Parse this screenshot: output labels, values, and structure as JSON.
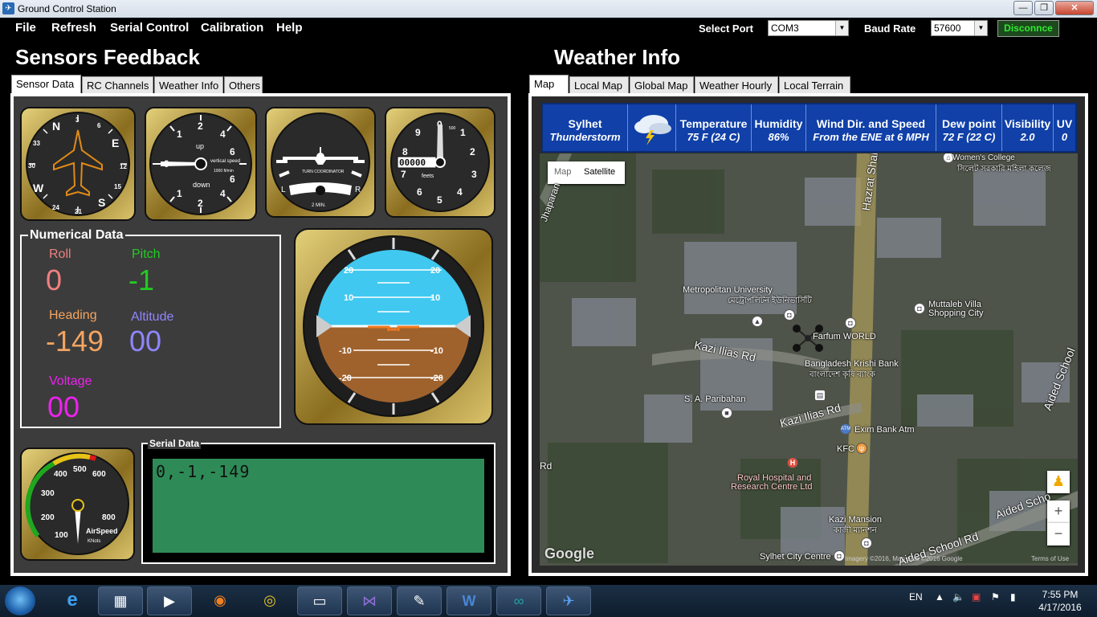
{
  "window": {
    "title": "Ground Control Station",
    "min": "—",
    "max": "❐",
    "close": "✕"
  },
  "menu": {
    "file": "File",
    "refresh": "Refresh",
    "serial_control": "Serial Control",
    "calibration": "Calibration",
    "help": "Help"
  },
  "port": {
    "label": "Select Port",
    "value": "COM3"
  },
  "baud": {
    "label": "Baud Rate",
    "value": "57600"
  },
  "disconnect_label": "Disconnce",
  "sensors": {
    "heading": "Sensors Feedback",
    "tabs": [
      "Sensor Data",
      "RC Channels",
      "Weather Info",
      "Others"
    ],
    "numerical": {
      "legend": "Numerical Data",
      "roll_label": "Roll",
      "roll_value": "0",
      "pitch_label": "Pitch",
      "pitch_value": "-1",
      "heading_label": "Heading",
      "heading_value": "-149",
      "altitude_label": "Altitude",
      "altitude_value": "00",
      "voltage_label": "Voltage",
      "voltage_value": "00"
    },
    "serial": {
      "legend": "Serial Data",
      "text": "0,-1,-149"
    },
    "gauges": {
      "compass": {
        "N": "N",
        "E": "E",
        "S": "S",
        "W": "W",
        "t3": "3",
        "t6": "6",
        "t12": "12",
        "t15": "15",
        "t21": "21",
        "t24": "24",
        "t30": "30",
        "t33": "33"
      },
      "vsi": {
        "up": "up",
        "down": "down",
        "title": "vertical speed",
        "unit": "1000 ft/min",
        "n0": "0",
        "n1": "1",
        "n2": "2",
        "n4": "4",
        "n6": "6"
      },
      "turn": {
        "title": "TURN COORDINATOR",
        "l": "L",
        "r": "R",
        "min": "2 MIN."
      },
      "alt": {
        "counter": "00000",
        "unit": "feets",
        "n0": "0",
        "n1": "1",
        "n2": "2",
        "n3": "3",
        "n4": "4",
        "n5": "5",
        "n6": "6",
        "n7": "7",
        "n8": "8",
        "n9": "9",
        "n500": "500"
      },
      "attitude": {
        "p20": "20",
        "p10": "10",
        "m10": "-10",
        "m20": "-20"
      },
      "airspeed": {
        "title": "AirSpeed",
        "unit": "KNots",
        "n100": "100",
        "n200": "200",
        "n300": "300",
        "n400": "400",
        "n500": "500",
        "n600": "600",
        "n800": "800"
      }
    }
  },
  "weather": {
    "heading": "Weather Info",
    "tabs": [
      "Map",
      "Local Map",
      "Global Map",
      "Weather Hourly",
      "Local Terrain"
    ],
    "location": "Sylhet",
    "condition": "Thunderstorm",
    "temperature_label": "Temperature",
    "temperature_value": "75 F (24 C)",
    "humidity_label": "Humidity",
    "humidity_value": "86%",
    "wind_label": "Wind Dir. and Speed",
    "wind_value": "From the ENE at 6 MPH",
    "dew_label": "Dew point",
    "dew_value": "72 F (22 C)",
    "visibility_label": "Visibility",
    "visibility_value": "2.0",
    "uv_label": "UV",
    "uv_value": "0"
  },
  "map": {
    "type_map": "Map",
    "type_satellite": "Satellite",
    "labels": {
      "metro": "Metropolitan University",
      "metro_bn": "মেট্রোপলিটন ইউনিভার্সিটি",
      "muttaleb": "Muttaleb Villa",
      "muttaleb2": "Shopping City",
      "farfum": "Farfum WORLD",
      "krishi": "Bangladesh Krishi Bank",
      "krishi_bn": "বাংলাদেশ কৃষি ব্যাংক",
      "paribahan": "S. A. Paribahan",
      "exim": "Exim Bank Atm",
      "kfc": "KFC",
      "royal": "Royal Hospital and",
      "royal2": "Research Centre Ltd",
      "kazi_mansion": "Kazi Mansion",
      "kazi_mansion_bn": "কাজী ম্যানশন",
      "city_centre": "Sylhet City Centre",
      "womens": "Women's College",
      "womens_bn": "সিলেট সরকারি মহিলা কলেজ",
      "road_kazi1": "Kazi Ilias Rd",
      "road_kazi2": "Kazi Ilias Rd",
      "road_hazrat": "Hazrat Shahjalal",
      "road_aided": "Aided School Rd",
      "road_aided2": "Aided Scho",
      "road_aided3": "Aided School",
      "road_jhaparan": "Jhaparan",
      "road_rd": "Rd",
      "google": "Google",
      "map_data": "Imagery ©2016, Map data ©2016 Google",
      "terms": "Terms of Use"
    },
    "zoom_in": "+",
    "zoom_out": "−"
  },
  "taskbar": {
    "lang": "EN",
    "time": "7:55 PM",
    "date": "4/17/2016",
    "apps": [
      "Internet Explorer",
      "File Explorer",
      "Media Player",
      "Firefox",
      "Chrome",
      "Photo Viewer",
      "Visual Studio",
      "Editor",
      "Word",
      "Arduino",
      "Ground Control Station"
    ]
  },
  "colors": {
    "roll": "#f08080",
    "pitch": "#22cc22",
    "heading": "#f4a460",
    "altitude": "#8f86ff",
    "voltage": "#ee22ee",
    "serial_bg": "#2e8b57",
    "weather_bar": "#1040a8",
    "sky": "#40c8f0",
    "ground": "#a0622d"
  }
}
